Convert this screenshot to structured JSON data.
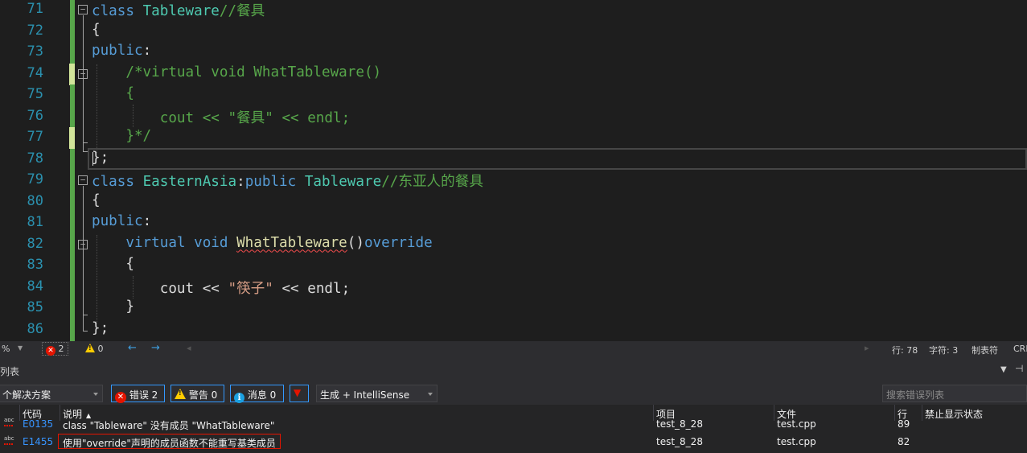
{
  "editor": {
    "lines": [
      {
        "num": "71",
        "tokens": [
          [
            "kw",
            "class "
          ],
          [
            "cls",
            "Tableware"
          ],
          [
            "cm",
            "//餐具"
          ]
        ]
      },
      {
        "num": "72",
        "tokens": [
          [
            "tx",
            "{"
          ]
        ]
      },
      {
        "num": "73",
        "tokens": [
          [
            "kw",
            "public"
          ],
          [
            "tx",
            ":"
          ]
        ]
      },
      {
        "num": "74",
        "tokens": [
          [
            "cm",
            "    /*virtual void WhatTableware()"
          ]
        ]
      },
      {
        "num": "75",
        "tokens": [
          [
            "cm",
            "    {"
          ]
        ]
      },
      {
        "num": "76",
        "tokens": [
          [
            "cm",
            "        cout << \"餐具\" << endl;"
          ]
        ]
      },
      {
        "num": "77",
        "tokens": [
          [
            "cm",
            "    }*/"
          ]
        ]
      },
      {
        "num": "78",
        "tokens": [
          [
            "tx",
            "};"
          ]
        ]
      },
      {
        "num": "79",
        "tokens": [
          [
            "kw",
            "class "
          ],
          [
            "cls",
            "EasternAsia"
          ],
          [
            "tx",
            ":"
          ],
          [
            "kw",
            "public "
          ],
          [
            "cls",
            "Tableware"
          ],
          [
            "cm",
            "//东亚人的餐具"
          ]
        ]
      },
      {
        "num": "80",
        "tokens": [
          [
            "tx",
            "{"
          ]
        ]
      },
      {
        "num": "81",
        "tokens": [
          [
            "kw",
            "public"
          ],
          [
            "tx",
            ":"
          ]
        ]
      },
      {
        "num": "82",
        "tokens": [
          [
            "tx",
            "    "
          ],
          [
            "kw",
            "virtual void "
          ],
          [
            "fnsq",
            "WhatTableware"
          ],
          [
            "tx",
            "()"
          ],
          [
            "kw",
            "override"
          ]
        ]
      },
      {
        "num": "83",
        "tokens": [
          [
            "tx",
            "    {"
          ]
        ]
      },
      {
        "num": "84",
        "tokens": [
          [
            "tx",
            "        cout << "
          ],
          [
            "str",
            "\"筷子\""
          ],
          [
            "tx",
            " << endl;"
          ]
        ]
      },
      {
        "num": "85",
        "tokens": [
          [
            "tx",
            "    }"
          ]
        ]
      },
      {
        "num": "86",
        "tokens": [
          [
            "tx",
            "};"
          ]
        ]
      }
    ]
  },
  "editor_status": {
    "zoom": "%",
    "error_count": "2",
    "warning_count": "0",
    "nav_back": "←",
    "nav_forward": "→",
    "line": "行: 78",
    "char": "字符: 3",
    "tab_mode": "制表符",
    "eol": "CRL"
  },
  "error_panel": {
    "title": "列表",
    "scope": "个解决方案",
    "errors_label": "错误 2",
    "warnings_label": "警告 0",
    "messages_label": "消息 0",
    "build_filter": "生成 + IntelliSense",
    "search_placeholder": "搜索错误列表",
    "columns": {
      "code": "代码",
      "desc": "说明",
      "project": "项目",
      "file": "文件",
      "line": "行",
      "suppress": "禁止显示状态"
    },
    "rows": [
      {
        "code": "E0135",
        "desc": "class \"Tableware\" 没有成员 \"WhatTableware\"",
        "project": "test_8_28",
        "file": "test.cpp",
        "line": "89"
      },
      {
        "code": "E1455",
        "desc": "使用\"override\"声明的成员函数不能重写基类成员",
        "project": "test_8_28",
        "file": "test.cpp",
        "line": "82"
      }
    ]
  },
  "colors": {
    "keyword": "#569cd6",
    "class": "#4ec9b0",
    "comment": "#57a64a",
    "string": "#d69d85",
    "error": "#e51400"
  }
}
